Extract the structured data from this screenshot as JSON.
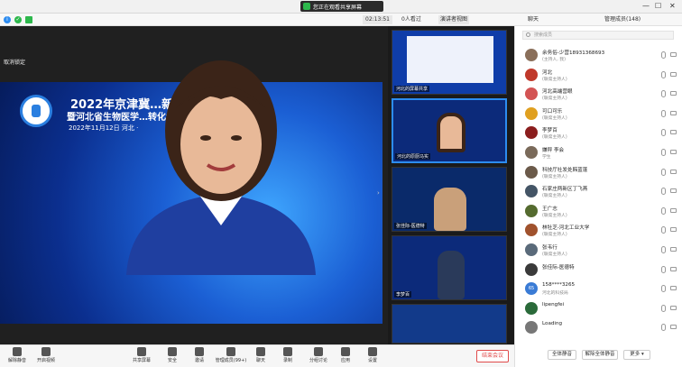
{
  "topbar": {
    "viewing_label": "您正在观看共享屏幕",
    "min": "—",
    "max": "☐",
    "close": "✕"
  },
  "toolbar": {
    "time": "02:13:51",
    "count_label": "0人看过",
    "speaker_view": "演讲者视图",
    "chat": "聊天",
    "manage": "管理成员(148)"
  },
  "main": {
    "cancel_pin": "取消锁定",
    "slide": {
      "title": "2022年京津冀…新发展高峰论坛",
      "subtitle": "暨河北省生物医学…转化专委会成立大会",
      "date": "2022年11月12日 河北 ·"
    }
  },
  "thumbs": [
    {
      "label": "河北的屏幕共享"
    },
    {
      "label": "河北的原厨马实"
    },
    {
      "label": "张佳际-医德特"
    },
    {
      "label": "李梦百"
    }
  ],
  "participants": [
    {
      "name": "余务俗-少营18931368693",
      "role": "(主持人, 我)",
      "color": "#8a6f5a"
    },
    {
      "name": "河北",
      "role": "(联席主持人)",
      "color": "#c0392b"
    },
    {
      "name": "河北高端营眼",
      "role": "(联席主持人)",
      "color": "#d35454"
    },
    {
      "name": "可口可乐",
      "role": "(联席主持人)",
      "color": "#e0a020"
    },
    {
      "name": "李梦百",
      "role": "(联席主持人)",
      "color": "#8b1e1e"
    },
    {
      "name": "嫌秤 李会",
      "role": "学生",
      "color": "#7a6a5a"
    },
    {
      "name": "科技厅社发处韩蓝蓬",
      "role": "(联席主持人)",
      "color": "#6b5a4a"
    },
    {
      "name": "石家庄两新区丁飞燕",
      "role": "(联席主持人)",
      "color": "#445566"
    },
    {
      "name": "王广志",
      "role": "(联席主持人)",
      "color": "#556b2f"
    },
    {
      "name": "林牡芝-河北工业大学",
      "role": "(联席主持人)",
      "color": "#a0522d"
    },
    {
      "name": "张韦行",
      "role": "(联席主持人)",
      "color": "#5a6a7a"
    },
    {
      "name": "张佳际-医德特",
      "role": "",
      "color": "#3a3a3a"
    },
    {
      "name": "158****3265",
      "role": "河北的科技局",
      "color": "#3a7bd5",
      "initial": "65"
    },
    {
      "name": "lipengfei",
      "role": "",
      "color": "#2a6a3a"
    },
    {
      "name": "Loading",
      "role": "",
      "color": "#777777"
    }
  ],
  "sidebar": {
    "search_placeholder": "搜索成员",
    "mute_all": "全体静音",
    "unmute_all": "解除全体静音",
    "more": "更多 ▾"
  },
  "bottombar": {
    "items": [
      {
        "label": "解除静音",
        "name": "unmute-button"
      },
      {
        "label": "开启视频",
        "name": "start-video-button"
      },
      {
        "label": "共享屏幕",
        "name": "share-screen-button"
      },
      {
        "label": "安全",
        "name": "security-button"
      },
      {
        "label": "邀请",
        "name": "invite-button"
      },
      {
        "label": "管理成员(99+)",
        "name": "manage-members-button"
      },
      {
        "label": "聊天",
        "name": "chat-button"
      },
      {
        "label": "录制",
        "name": "record-button"
      },
      {
        "label": "分组讨论",
        "name": "breakout-button"
      },
      {
        "label": "应用",
        "name": "apps-button"
      },
      {
        "label": "设置",
        "name": "settings-button"
      }
    ],
    "end": "结束会议"
  }
}
